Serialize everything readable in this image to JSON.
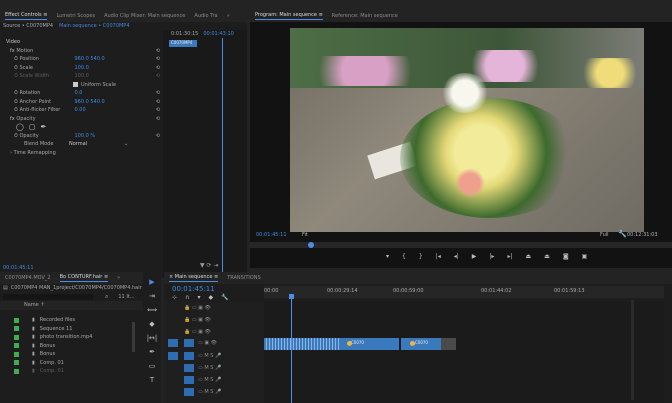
{
  "effect_controls": {
    "tabs": [
      "Effect Controls ≡",
      "Lumetri Scopes",
      "Audio Clip Mixer: Main sequence",
      "Audio Tra",
      "»"
    ],
    "source": "Source • C0070MP4",
    "sequence": "Main sequence • C0070MP4",
    "mini_time": "0:01:30:15",
    "mini_time2": "00:01:43:10",
    "clip_label": "C0070MP4",
    "video_label": "Video",
    "rows": [
      {
        "label": "Motion",
        "value": ""
      },
      {
        "label": "Position",
        "value": "960.0   540.0"
      },
      {
        "label": "Scale",
        "value": "100.0"
      },
      {
        "label": "Scale Width",
        "value": "100.0"
      },
      {
        "label": "",
        "value": "Uniform Scale"
      },
      {
        "label": "Rotation",
        "value": "0.0"
      },
      {
        "label": "Anchor Point",
        "value": "960.0   540.0"
      },
      {
        "label": "Anti-flicker Filter",
        "value": "0.00"
      },
      {
        "label": "Opacity",
        "value": ""
      },
      {
        "label": "",
        "value": ""
      },
      {
        "label": "Opacity",
        "value": "100.0 %"
      },
      {
        "label": "Blend Mode",
        "value": "Normal"
      },
      {
        "label": "Time Remapping",
        "value": ""
      }
    ],
    "bottom_time": "00:01:45:11"
  },
  "program": {
    "tabs": [
      "Program: Main sequence ≡",
      "Reference: Main sequence"
    ],
    "timecode": "00:01:45:11",
    "fit": "Fit",
    "full": "Full",
    "duration": "00:12:31:03"
  },
  "project": {
    "tabs": [
      "C0070MP4.MOV_2",
      "Bo CONTURF.hair ≡",
      "»"
    ],
    "path": "C0070MP4 MAN_1project/C0070MP4/C0070MP4.hair",
    "items_label": "11 It...",
    "name_header": "Name ↑",
    "items": [
      "Recorded files",
      "Sequence 11",
      "photo transition.mp4",
      "Bonus",
      "Bonus",
      "Comp. 01",
      "Comp. 01"
    ]
  },
  "timeline": {
    "tabs": [
      "× Main sequence ≡",
      "TRANSITIONS"
    ],
    "timecode": "00:01:45:11",
    "ruler": [
      "00:00",
      "00:00:29:14",
      "00:00:59:00",
      "00:01:44:02",
      "00:01:59:13"
    ],
    "clip_label": "C0070",
    "clip_label2": "C0070"
  },
  "colors": {
    "accent": "#4a8ee5",
    "clip": "#3b79bd",
    "label_green": "#3fae4e",
    "timecode": "#3d8ae0"
  }
}
